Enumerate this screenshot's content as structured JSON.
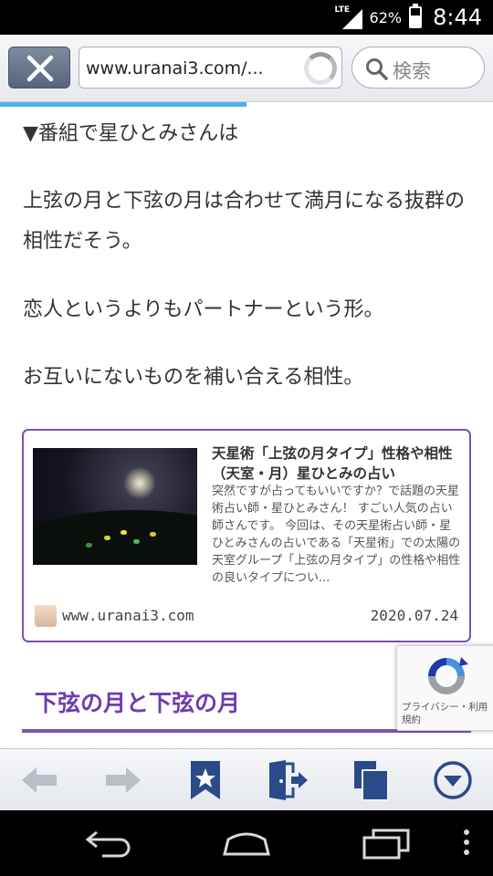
{
  "status": {
    "network": "LTE",
    "battery_pct": "62%",
    "battery_level": 0.62,
    "time": "8:44"
  },
  "browser": {
    "url": "www.uranai3.com/...",
    "search_label": "検索",
    "load_progress": 0.5
  },
  "article": {
    "paragraphs": [
      "▼番組で星ひとみさんは",
      "上弦の月と下弦の月は合わせて満月になる抜群の相性だそう。",
      "恋人というよりもパートナーという形。",
      "お互いにないものを補い合える相性。"
    ],
    "card": {
      "title": "天星術「上弦の月タイプ」性格や相性（天室・月）星ひとみの占い",
      "description": "突然ですが占ってもいいですか？で話題の天星術占い師・星ひとみさん！ すごい人気の占い師さんです。 今回は、その天星術占い師・星ひとみさんの占いである「天星術」での太陽の天室グループ「上弦の月タイプ」の性格や相性の良いタイプについ...",
      "domain": "www.uranai3.com",
      "date": "2020.07.24"
    },
    "section_heading": "下弦の月と下弦の月"
  },
  "recaptcha": {
    "text": "プライバシー・利用規約"
  },
  "colors": {
    "accent_purple": "#7d53b0",
    "heading_purple": "#6f3bb2",
    "progress_blue": "#4db4e8",
    "bookmark_blue": "#2b4a8a"
  },
  "icons": {
    "toolbar": [
      "close-icon",
      "reload-spinner-icon",
      "search-icon"
    ],
    "bottom": [
      "back-arrow-icon",
      "forward-arrow-icon",
      "bookmark-star-icon",
      "exit-door-icon",
      "tabs-icon",
      "menu-down-icon"
    ],
    "system": [
      "system-back-icon",
      "system-home-icon",
      "system-recents-icon",
      "system-menu-icon"
    ]
  }
}
